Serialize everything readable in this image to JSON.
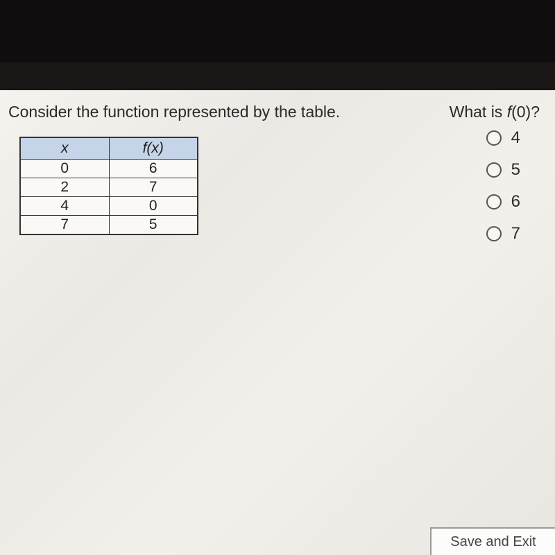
{
  "prompt": "Consider the function represented by the table.",
  "question_prefix": "What is ",
  "question_func": "f",
  "question_arg": "(0)?",
  "table": {
    "header_x": "x",
    "header_fx": "f(x)",
    "rows": [
      {
        "x": "0",
        "fx": "6"
      },
      {
        "x": "2",
        "fx": "7"
      },
      {
        "x": "4",
        "fx": "0"
      },
      {
        "x": "7",
        "fx": "5"
      }
    ]
  },
  "options": [
    {
      "label": "4"
    },
    {
      "label": "5"
    },
    {
      "label": "6"
    },
    {
      "label": "7"
    }
  ],
  "footer": {
    "save_exit": "Save and Exit"
  }
}
